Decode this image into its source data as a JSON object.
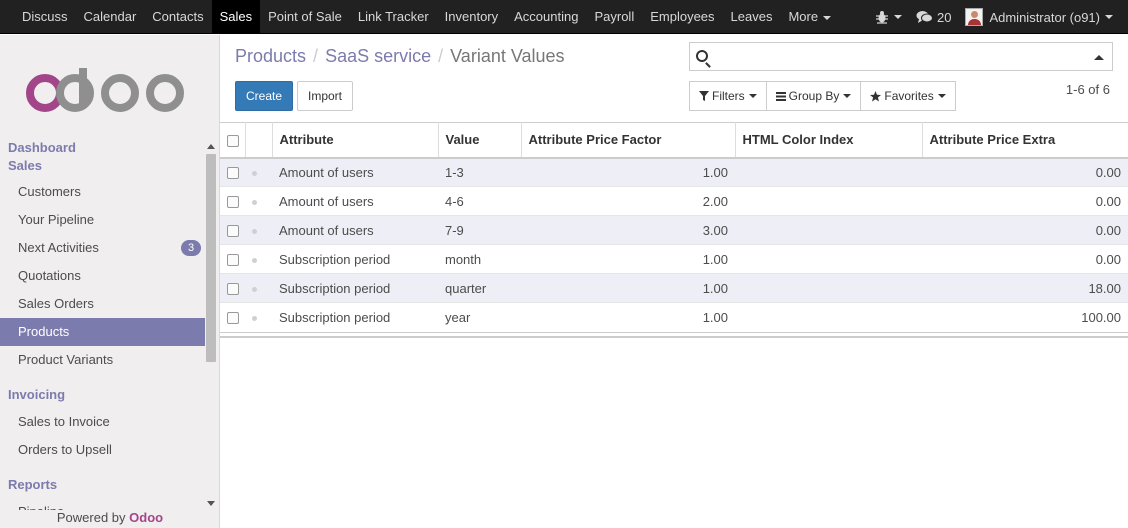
{
  "topbar": {
    "menu": [
      "Discuss",
      "Calendar",
      "Contacts",
      "Sales",
      "Point of Sale",
      "Link Tracker",
      "Inventory",
      "Accounting",
      "Payroll",
      "Employees",
      "Leaves"
    ],
    "active": "Sales",
    "more": "More",
    "messages_count": "20",
    "user": "Administrator (o91)"
  },
  "sidebar": {
    "sections": [
      {
        "title": "Dashboard"
      },
      {
        "title": "Sales",
        "items": [
          "Customers",
          "Your Pipeline",
          "Next Activities",
          "Quotations",
          "Sales Orders",
          "Products",
          "Product Variants"
        ]
      },
      {
        "title": "Invoicing",
        "items": [
          "Sales to Invoice",
          "Orders to Upsell"
        ]
      },
      {
        "title": "Reports",
        "items": [
          "Pipeline"
        ]
      }
    ],
    "next_activities_badge": "3",
    "active_item": "Products",
    "powered_by": "Powered by",
    "powered_brand": "Odoo"
  },
  "breadcrumb": [
    "Products",
    "SaaS service",
    "Variant Values"
  ],
  "buttons": {
    "create": "Create",
    "import": "Import"
  },
  "search": {
    "placeholder": ""
  },
  "filters": {
    "filters": "Filters",
    "group_by": "Group By",
    "favorites": "Favorites"
  },
  "pager": "1-6 of 6",
  "table": {
    "columns": [
      "Attribute",
      "Value",
      "Attribute Price Factor",
      "HTML Color Index",
      "Attribute Price Extra"
    ],
    "rows": [
      {
        "attribute": "Amount of users",
        "value": "1-3",
        "factor": "1.00",
        "color": "",
        "extra": "0.00"
      },
      {
        "attribute": "Amount of users",
        "value": "4-6",
        "factor": "2.00",
        "color": "",
        "extra": "0.00"
      },
      {
        "attribute": "Amount of users",
        "value": "7-9",
        "factor": "3.00",
        "color": "",
        "extra": "0.00"
      },
      {
        "attribute": "Subscription period",
        "value": "month",
        "factor": "1.00",
        "color": "",
        "extra": "0.00"
      },
      {
        "attribute": "Subscription period",
        "value": "quarter",
        "factor": "1.00",
        "color": "",
        "extra": "18.00"
      },
      {
        "attribute": "Subscription period",
        "value": "year",
        "factor": "1.00",
        "color": "",
        "extra": "100.00"
      }
    ]
  },
  "colors": {
    "brand": "#7c7bad",
    "primary": "#337ab7",
    "topbar": "#212121",
    "odoo_logo": "#a24689"
  }
}
